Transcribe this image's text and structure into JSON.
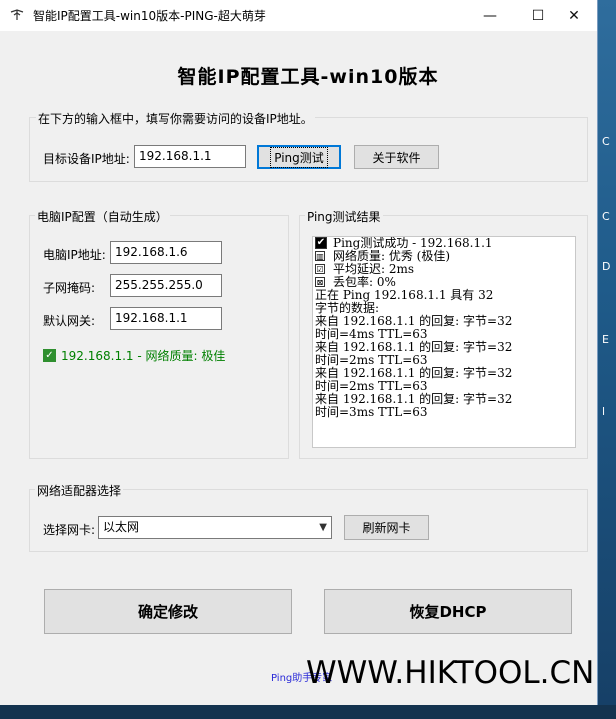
{
  "window": {
    "title": "智能IP配置工具-win10版本-PING-超大萌芽",
    "controls": {
      "minimize": "—",
      "maximize": "☐",
      "close": "✕"
    }
  },
  "heading": "智能IP配置工具-win10版本",
  "target_group": {
    "instruction": "在下方的输入框中，填写你需要访问的设备IP地址。",
    "target_label": "目标设备IP地址:",
    "target_value": "192.168.1.1",
    "ping_button": "Ping测试",
    "about_button": "关于软件"
  },
  "pc_group": {
    "title": "电脑IP配置（自动生成）",
    "ip_label": "电脑IP地址:",
    "ip_value": "192.168.1.6",
    "mask_label": "子网掩码:",
    "mask_value": "255.255.255.0",
    "gateway_label": "默认网关:",
    "gateway_value": "192.168.1.1",
    "status_text": "192.168.1.1 - 网络质量: 极佳"
  },
  "ping_group": {
    "title": "Ping测试结果",
    "summary": [
      {
        "icon": "check-icon",
        "glyph": "✔",
        "text": "Ping测试成功 - 192.168.1.1"
      },
      {
        "icon": "quality-icon",
        "glyph": "▥",
        "text": "网络质量: 优秀 (极佳)"
      },
      {
        "icon": "delay-icon",
        "glyph": "☑",
        "text": "平均延迟: 2ms"
      },
      {
        "icon": "loss-icon",
        "glyph": "⊠",
        "text": "丢包率: 0%"
      }
    ],
    "log": [
      "",
      "正在 Ping 192.168.1.1 具有 32",
      "字节的数据:",
      "来自 192.168.1.1 的回复: 字节=32",
      "时间=4ms TTL=63",
      "来自 192.168.1.1 的回复: 字节=32",
      "时间=2ms TTL=63",
      "来自 192.168.1.1 的回复: 字节=32",
      "时间=2ms TTL=63",
      "来自 192.168.1.1 的回复: 字节=32",
      "时间=3ms TTL=63"
    ]
  },
  "adapter_group": {
    "title": "网络适配器选择",
    "select_label": "选择网卡:",
    "selected": "以太网",
    "refresh_button": "刷新网卡"
  },
  "actions": {
    "apply_button": "确定修改",
    "dhcp_button": "恢复DHCP"
  },
  "footer": {
    "ping_link": "Ping助手专家",
    "watermark": "WWW.HIKTOOL.CN"
  },
  "desktop": {
    "edge_chars": [
      "C",
      "C",
      "D",
      "E",
      "l"
    ]
  }
}
